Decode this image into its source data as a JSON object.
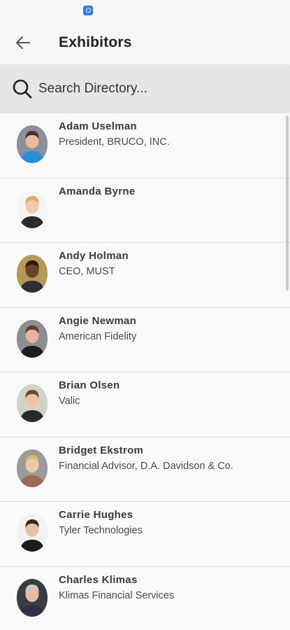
{
  "header": {
    "title": "Exhibitors"
  },
  "search": {
    "placeholder": "Search Directory..."
  },
  "exhibitors": [
    {
      "name": "Adam Uselman",
      "subtitle": "President, BRUCO, INC.",
      "shirt": "#2a8fd8",
      "bg": "#8a8f99",
      "skin": "#e9b99a",
      "hair": "#4a3326"
    },
    {
      "name": "Amanda Byrne",
      "subtitle": "",
      "shirt": "#2b2b2b",
      "bg": "#f4f4f4",
      "skin": "#f1c9a8",
      "hair": "#d6b06a"
    },
    {
      "name": "Andy Holman",
      "subtitle": "CEO, MUST",
      "shirt": "#2f2f35",
      "bg": "#b39a58",
      "skin": "#6b4428",
      "hair": "#2a1a12"
    },
    {
      "name": "Angie Newman",
      "subtitle": "American Fidelity",
      "shirt": "#1d1d1d",
      "bg": "#8b8e93",
      "skin": "#e7b59b",
      "hair": "#6a3b24"
    },
    {
      "name": "Brian Olsen",
      "subtitle": "Valic",
      "shirt": "#2a2a2e",
      "bg": "#cfd4c9",
      "skin": "#edc3a3",
      "hair": "#6b4a2f"
    },
    {
      "name": "Bridget Ekstrom",
      "subtitle": "Financial Advisor, D.A. Davidson & Co.",
      "shirt": "#9b6b55",
      "bg": "#9c9a98",
      "skin": "#f0c9ac",
      "hair": "#d8b873"
    },
    {
      "name": "Carrie Hughes",
      "subtitle": "Tyler Technologies",
      "shirt": "#1a1a1a",
      "bg": "#f2f2f2",
      "skin": "#ecc0a2",
      "hair": "#3a261c"
    },
    {
      "name": "Charles Klimas",
      "subtitle": "Klimas Financial Services",
      "shirt": "#2a3246",
      "bg": "#3a3c42",
      "skin": "#e8bca0",
      "hair": "#c9c9c9"
    }
  ]
}
